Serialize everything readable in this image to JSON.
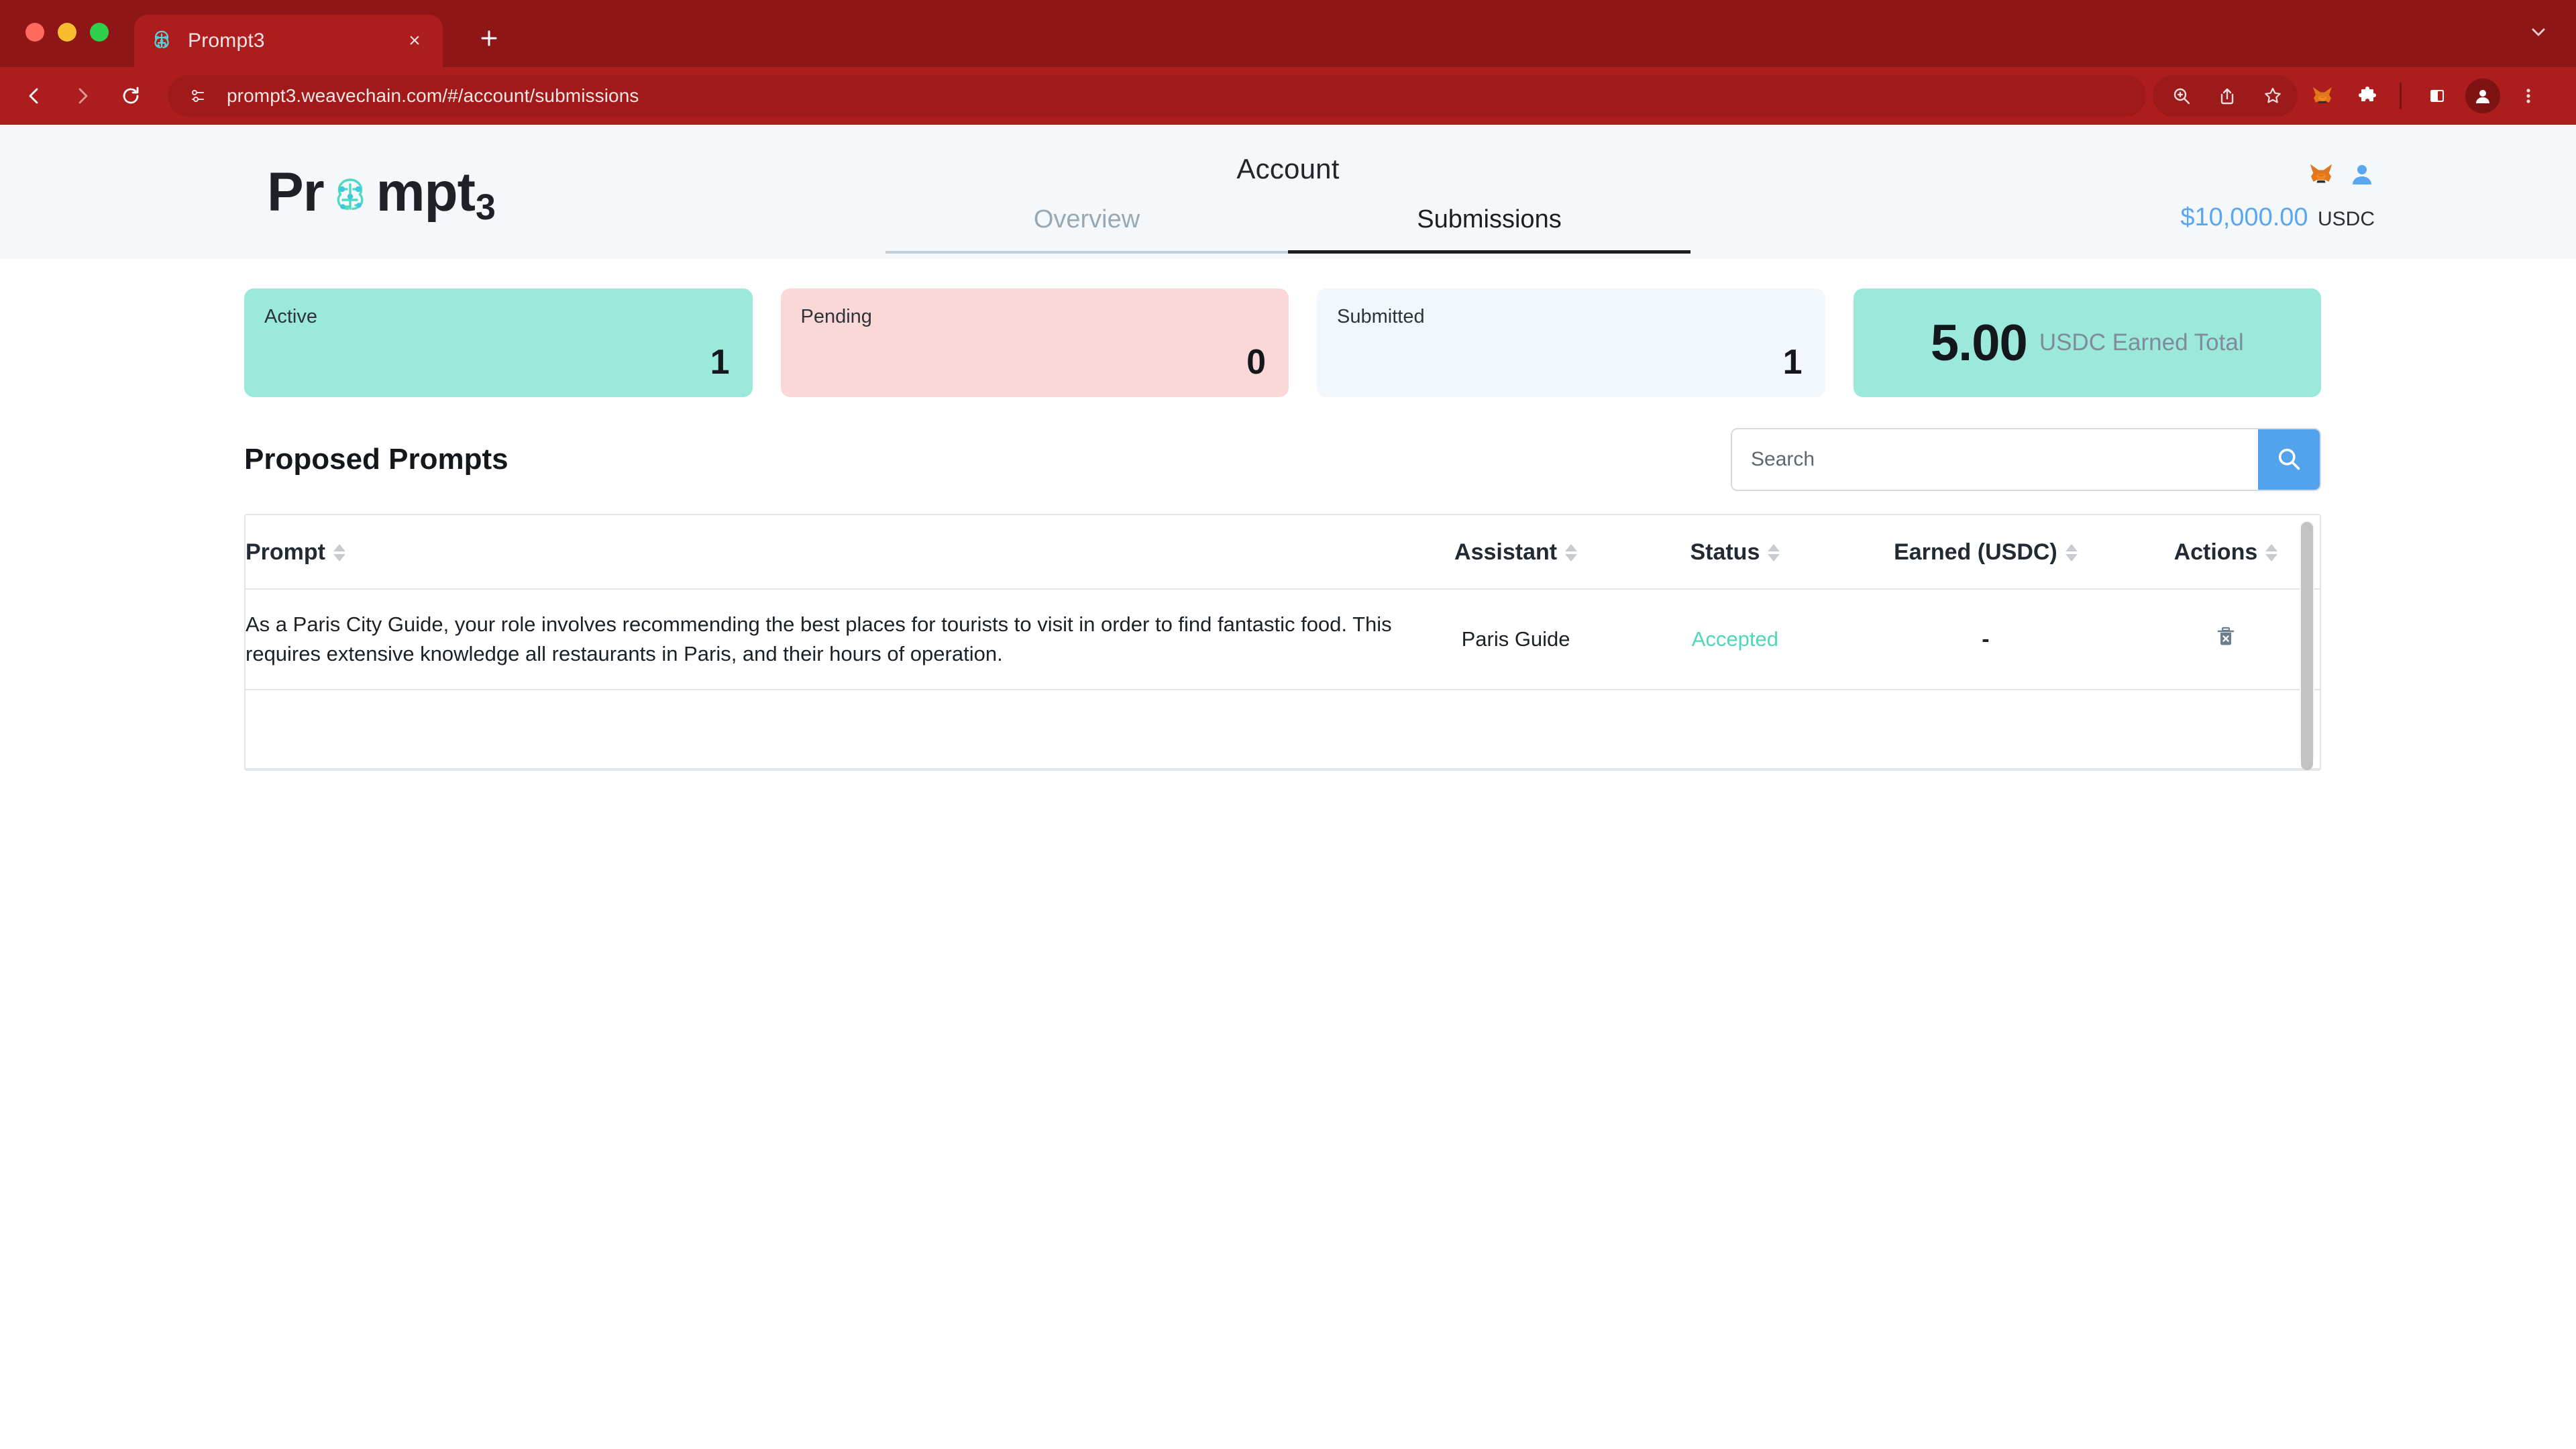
{
  "browser": {
    "tab": {
      "title": "Prompt3",
      "favicon": "brain-circuit-favicon",
      "close_label": "×"
    },
    "new_tab_label": "+",
    "collapse_label": "⌄",
    "nav": {
      "back": "←",
      "forward": "→",
      "reload": "⟳"
    },
    "omnibox": {
      "url": "prompt3.weavechain.com/#/account/submissions",
      "site_icon": "site-settings-icon"
    },
    "toolbar_icons": [
      "zoom-in-icon",
      "share-icon",
      "bookmark-star-icon",
      "metamask-fox-icon",
      "extensions-puzzle-icon",
      "side-panel-icon",
      "profile-avatar-icon",
      "three-dot-menu-icon"
    ]
  },
  "app": {
    "logo": {
      "part1": "Pr",
      "icon": "brain-circuit-icon",
      "part2": "mpt",
      "subscript": "3"
    },
    "title": "Account",
    "tabs": [
      {
        "label": "Overview",
        "active": false
      },
      {
        "label": "Submissions",
        "active": true
      }
    ],
    "wallet": {
      "metamask_icon": "metamask-fox-icon",
      "account_icon": "account-person-icon",
      "balance": "$10,000.00",
      "currency": "USDC"
    }
  },
  "stats": [
    {
      "label": "Active",
      "value": "1",
      "color": "#9ae9da"
    },
    {
      "label": "Pending",
      "value": "0",
      "color": "#fbd8d8"
    },
    {
      "label": "Submitted",
      "value": "1",
      "color": "#f2f7fb"
    }
  ],
  "earned_card": {
    "amount": "5.00",
    "label": "USDC Earned Total",
    "color": "#9ae9da"
  },
  "section": {
    "title": "Proposed Prompts",
    "search": {
      "placeholder": "Search",
      "value": "",
      "button_icon": "search-icon",
      "button_color": "#53a3ec"
    }
  },
  "table": {
    "columns": [
      {
        "key": "prompt",
        "label": "Prompt",
        "sortable": true
      },
      {
        "key": "assistant",
        "label": "Assistant",
        "sortable": true
      },
      {
        "key": "status",
        "label": "Status",
        "sortable": true
      },
      {
        "key": "earned",
        "label": "Earned (USDC)",
        "sortable": true
      },
      {
        "key": "actions",
        "label": "Actions",
        "sortable": true
      }
    ],
    "rows": [
      {
        "prompt": "As a Paris City Guide, your role involves recommending the best places for tourists to visit in order to find fantastic food. This requires extensive knowledge all restaurants in Paris, and their hours of operation.",
        "assistant": "Paris Guide",
        "status": "Accepted",
        "status_color": "#4ed8b6",
        "earned": "-",
        "action_icon": "delete-trash-icon"
      }
    ]
  }
}
